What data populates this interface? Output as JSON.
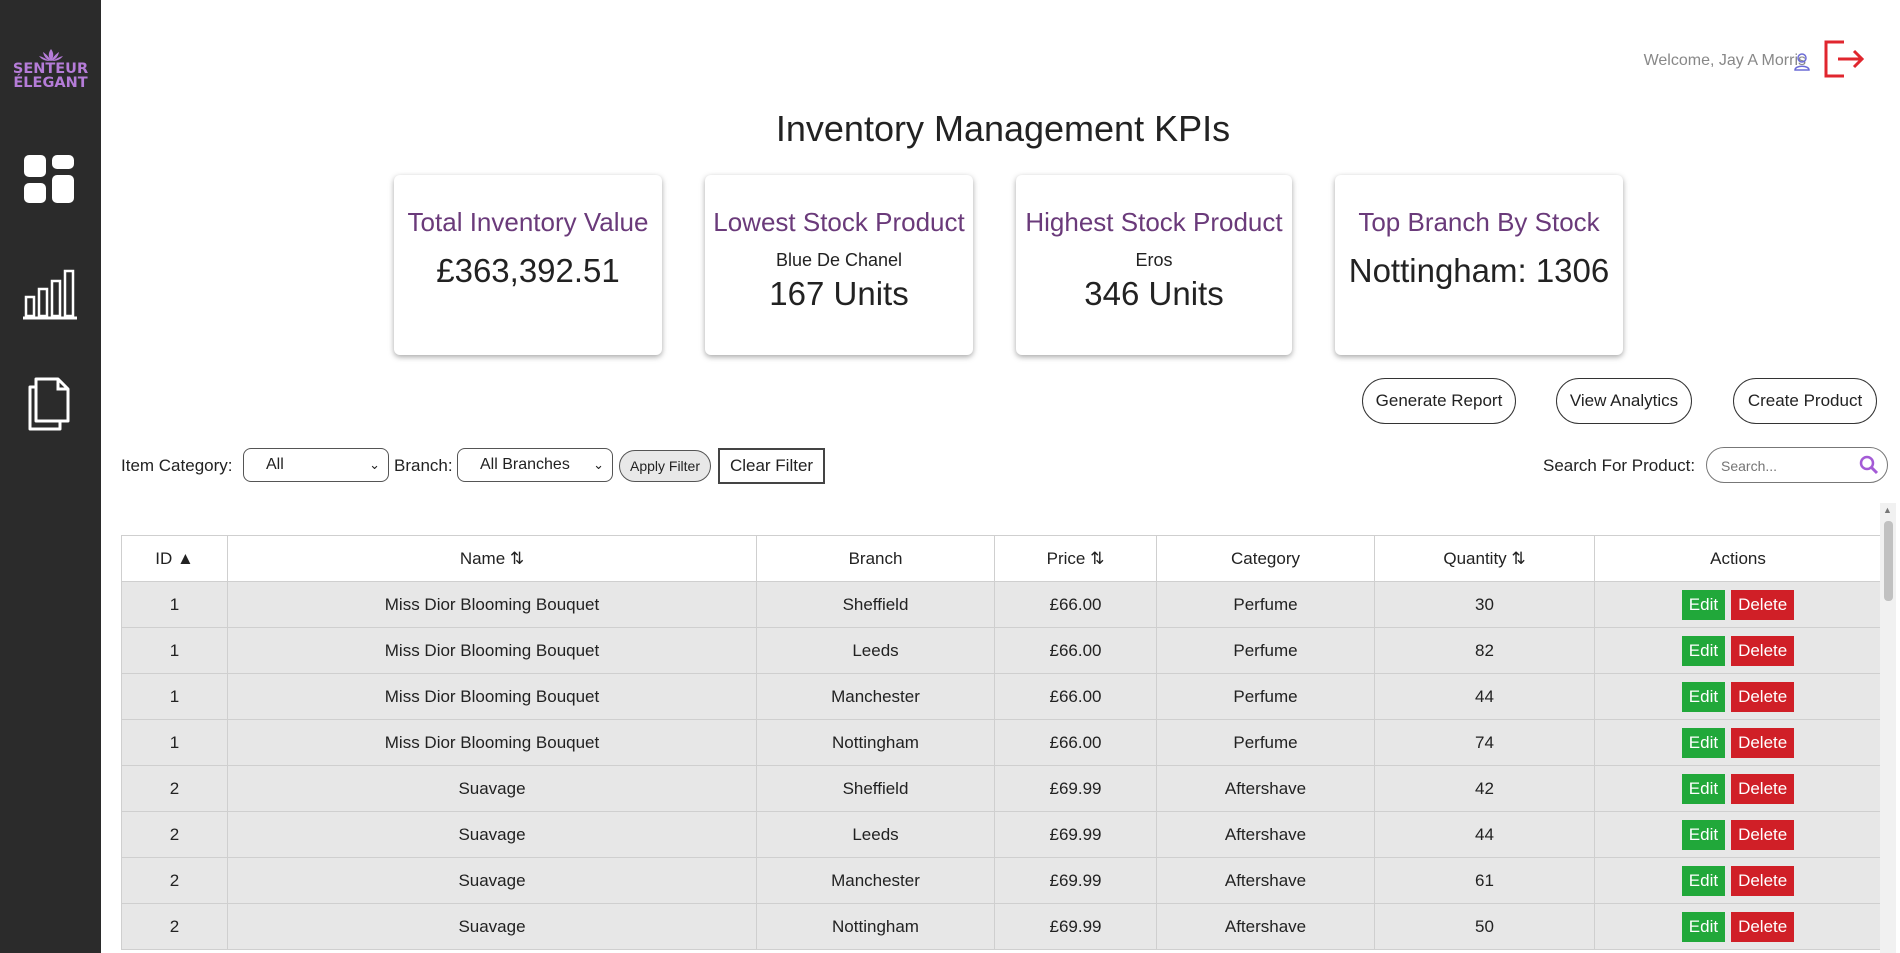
{
  "app": {
    "logo_line1": "SENTEUR",
    "logo_line2": "ÉLEGANT",
    "brand_color": "#b57cd8",
    "welcome_text": "Welcome, Jay A Morris"
  },
  "sidebar": {
    "items": [
      {
        "name": "dashboard",
        "icon": "dashboard-grid-icon"
      },
      {
        "name": "analytics",
        "icon": "bar-chart-icon"
      },
      {
        "name": "documents",
        "icon": "documents-icon"
      }
    ]
  },
  "page": {
    "title": "Inventory Management KPIs"
  },
  "kpis": {
    "total_value": {
      "title": "Total Inventory Value",
      "value": "£363,392.51"
    },
    "lowest_stock": {
      "title": "Lowest Stock Product",
      "product": "Blue De Chanel",
      "value": "167 Units"
    },
    "highest_stock": {
      "title": "Highest Stock Product",
      "product": "Eros",
      "value": "346 Units"
    },
    "top_branch": {
      "title": "Top Branch By Stock",
      "value": "Nottingham: 1306"
    }
  },
  "actions": {
    "generate_report": "Generate Report",
    "view_analytics": "View Analytics",
    "create_product": "Create Product"
  },
  "filters": {
    "category_label": "Item Category:",
    "category_value": "All",
    "branch_label": "Branch:",
    "branch_value": "All Branches",
    "apply_label": "Apply Filter",
    "clear_label": "Clear Filter",
    "search_label": "Search For Product:",
    "search_placeholder": "Search..."
  },
  "table": {
    "headers": {
      "id": "ID ▲",
      "name": "Name ⇅",
      "branch": "Branch",
      "price": "Price ⇅",
      "category": "Category",
      "quantity": "Quantity ⇅",
      "actions": "Actions"
    },
    "edit_label": "Edit",
    "delete_label": "Delete",
    "edit_color": "#21a83a",
    "delete_color": "#d01f27",
    "rows": [
      {
        "id": "1",
        "name": "Miss Dior Blooming Bouquet",
        "branch": "Sheffield",
        "price": "£66.00",
        "category": "Perfume",
        "quantity": "30"
      },
      {
        "id": "1",
        "name": "Miss Dior Blooming Bouquet",
        "branch": "Leeds",
        "price": "£66.00",
        "category": "Perfume",
        "quantity": "82"
      },
      {
        "id": "1",
        "name": "Miss Dior Blooming Bouquet",
        "branch": "Manchester",
        "price": "£66.00",
        "category": "Perfume",
        "quantity": "44"
      },
      {
        "id": "1",
        "name": "Miss Dior Blooming Bouquet",
        "branch": "Nottingham",
        "price": "£66.00",
        "category": "Perfume",
        "quantity": "74"
      },
      {
        "id": "2",
        "name": "Suavage",
        "branch": "Sheffield",
        "price": "£69.99",
        "category": "Aftershave",
        "quantity": "42"
      },
      {
        "id": "2",
        "name": "Suavage",
        "branch": "Leeds",
        "price": "£69.99",
        "category": "Aftershave",
        "quantity": "44"
      },
      {
        "id": "2",
        "name": "Suavage",
        "branch": "Manchester",
        "price": "£69.99",
        "category": "Aftershave",
        "quantity": "61"
      },
      {
        "id": "2",
        "name": "Suavage",
        "branch": "Nottingham",
        "price": "£69.99",
        "category": "Aftershave",
        "quantity": "50"
      }
    ]
  }
}
